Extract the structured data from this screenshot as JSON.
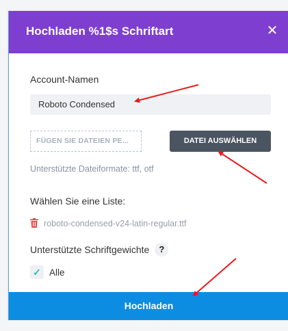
{
  "dialog": {
    "title": "Hochladen %1$s Schriftart",
    "close_label": "✕"
  },
  "form": {
    "account_label": "Account-Namen",
    "account_value": "Roboto Condensed",
    "dropzone_label": "FÜGEN SIE DATEIEN PE...",
    "choose_button": "DATEI AUSWÄHLEN",
    "formats_hint": "Unterstützte Dateiformate: ttf, otf",
    "list_label": "Wählen Sie eine Liste:",
    "file_name": "roboto-condensed-v24-latin-regular.ttf",
    "weights_label": "Unterstützte Schriftgewichte",
    "help_label": "?",
    "weight_option": "Alle",
    "weight_checked": true
  },
  "footer": {
    "upload_button": "Hochladen"
  },
  "colors": {
    "header": "#7e3ecf",
    "primary_button": "#0c8de1",
    "secondary_button": "#4b5561",
    "annotation_arrow": "#e8191c",
    "trash_icon": "#e34a4a",
    "check_icon": "#2ebdb3"
  },
  "icons": {
    "close": "close-icon",
    "trash": "trash-icon",
    "help": "help-icon",
    "check": "checkmark-icon"
  }
}
